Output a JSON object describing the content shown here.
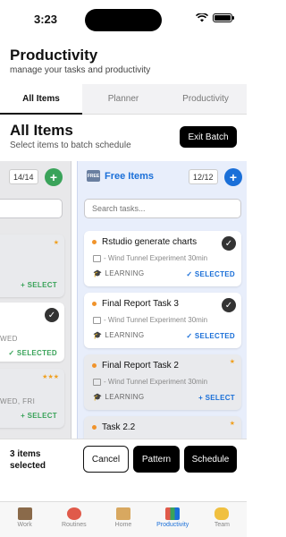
{
  "status_bar": {
    "time": "3:23"
  },
  "header": {
    "title": "Productivity",
    "subtitle": "manage your tasks and productivity"
  },
  "tabs": [
    {
      "label": "All Items",
      "active": true
    },
    {
      "label": "Planner",
      "active": false
    },
    {
      "label": "Productivity",
      "active": false
    }
  ],
  "section": {
    "title": "All Items",
    "subtitle": "Select items to batch schedule",
    "exit_label": "Exit Batch"
  },
  "left_column": {
    "count": "14/14",
    "cards": [
      {
        "days": "",
        "status": "+ SELECT",
        "stars": "★"
      },
      {
        "days": "WED",
        "status": "✓ SELECTED",
        "stars": ""
      },
      {
        "days": "WED, FRI",
        "status": "+ SELECT",
        "stars": "★★★"
      }
    ]
  },
  "right_column": {
    "icon_text": "FREE",
    "title": "Free Items",
    "count": "12/12",
    "search_placeholder": "Search tasks...",
    "cards": [
      {
        "title": "Rstudio generate charts",
        "detail": "- Wind Tunnel Experiment 30min",
        "tag": "LEARNING",
        "status": "✓ SELECTED",
        "selected": true,
        "stars": ""
      },
      {
        "title": "Final Report Task 3",
        "detail": "- Wind Tunnel Experiment 30min",
        "tag": "LEARNING",
        "status": "✓ SELECTED",
        "selected": true,
        "stars": ""
      },
      {
        "title": "Final Report Task 2",
        "detail": "- Wind Tunnel Experiment 30min",
        "tag": "LEARNING",
        "status": "+ SELECT",
        "selected": false,
        "stars": "★"
      },
      {
        "title": "Task 2.2",
        "detail": "",
        "tag": "",
        "status": "",
        "selected": false,
        "stars": "★"
      }
    ]
  },
  "action_bar": {
    "selected_count": "3 items selected",
    "cancel": "Cancel",
    "pattern": "Pattern",
    "schedule": "Schedule"
  },
  "tab_bar": [
    {
      "label": "Work",
      "icon": "briefcase-icon",
      "active": false
    },
    {
      "label": "Routines",
      "icon": "alarm-clock-icon",
      "active": false
    },
    {
      "label": "Home",
      "icon": "house-icon",
      "active": false
    },
    {
      "label": "Productivity",
      "icon": "bar-chart-icon",
      "active": true
    },
    {
      "label": "Team",
      "icon": "handshake-icon",
      "active": false
    }
  ],
  "colors": {
    "accent": "#1a6fd8",
    "green": "#3aa35a",
    "orange": "#f0932b"
  }
}
